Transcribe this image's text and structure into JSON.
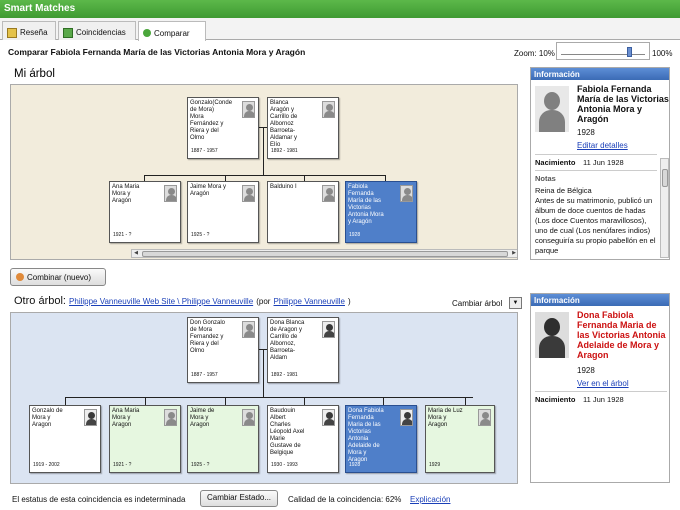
{
  "window_title": "Smart Matches",
  "tabs": [
    {
      "label": "Reseña",
      "icon": "overview-icon"
    },
    {
      "label": "Coincidencias",
      "icon": "matches-icon"
    },
    {
      "label": "Comparar",
      "icon": "compare-people-icon"
    }
  ],
  "page_title": "Comparar Fabiola Fernanda María de las Victorias Antonia Mora y Aragón",
  "zoom": {
    "label": "Zoom: 10%",
    "max_label": "100%",
    "level_percent": 78
  },
  "my_tree": {
    "header": "Mi árbol",
    "cards": [
      {
        "name": "Gonzalo(Conde de Mora) Mora Fernández y Riera y del Olmo",
        "dates": "1887 - 1957"
      },
      {
        "name": "Blanca Aragón y Carrillo de Albornoz Barroeta-Aldamar y Elío",
        "dates": "1892 - 1981"
      },
      {
        "name": "Ana Maria Mora y Aragón",
        "dates": "1921 - ?"
      },
      {
        "name": "Jaime Mora y Aragón",
        "dates": "1925 - ?"
      },
      {
        "name": "Balduino I",
        "dates": ""
      },
      {
        "name": "Fabiola Fernanda María de las Victorias Antonia Mora y Aragón",
        "dates": "1928"
      }
    ],
    "info": {
      "header": "Información",
      "name": "Fabiola Fernanda María de las Victorias Antonia Mora y Aragón",
      "year": "1928",
      "edit_link": "Editar detalles",
      "birth_label": "Nacimiento",
      "birth_value": "11 Jun 1928",
      "notes_label": "Notas",
      "notes_text": "Reina de Bélgica\nAntes de su matrimonio, publicó un álbum de doce cuentos de hadas (Los doce Cuentos maravillosos), uno de cual (Los nenúfares indios) conseguiría su propio pabellón en el parque"
    }
  },
  "merge_button": "Combinar (nuevo)",
  "other_tree": {
    "label": "Otro árbol:",
    "site_link": "Philippe Vanneuville Web Site \\ Philippe Vanneuville",
    "by_text": "(por",
    "author_link": "Philippe Vanneuville",
    "by_close": ")",
    "change_tree": "Cambiar árbol",
    "cards": [
      {
        "name": "Don Gonzalo de Mora Fernandez y Riera y del Olmo",
        "dates": "1887 - 1957"
      },
      {
        "name": "Dona Blanca de Aragon y Carrillo de Albornoz, Barroeta-Aldam",
        "dates": "1892 - 1981"
      },
      {
        "name": "Gonzalo de Mora y Aragon",
        "dates": "1919 - 2002"
      },
      {
        "name": "Ana Maria Mora y Aragon",
        "dates": "1921 - ?"
      },
      {
        "name": "Jaime de Mora y Aragon",
        "dates": "1925 - ?"
      },
      {
        "name": "Baudouin Albert Charles Léopold Axel Marie Gustave de Belgique",
        "dates": "1930 - 1993"
      },
      {
        "name": "Dona Fabiola Fernanda Maria de las Victorias Antonia Adelaide de Mora y Aragon",
        "dates": "1928"
      },
      {
        "name": "Maria de Luz Mora y Aragon",
        "dates": "1929"
      }
    ],
    "info": {
      "header": "Información",
      "name": "Dona Fabiola Fernanda Maria de las Victorias Antonia Adelaide de Mora y Aragon",
      "year": "1928",
      "view_link": "Ver en el árbol",
      "birth_label": "Nacimiento",
      "birth_value": "11 Jun 1928"
    }
  },
  "status": {
    "text": "El estatus de esta coincidencia es indeterminada",
    "change_button": "Cambiar Estado...",
    "quality": "Calidad de la coincidencia: 62%",
    "explain_link": "Explicación"
  },
  "colors": {
    "my_tree_bg": "#f2ecdc",
    "other_tree_bg": "#dbe4f2",
    "selected": "#4f7fc9",
    "name_red": "#cc1111",
    "accent_green": "#4aa63b"
  }
}
